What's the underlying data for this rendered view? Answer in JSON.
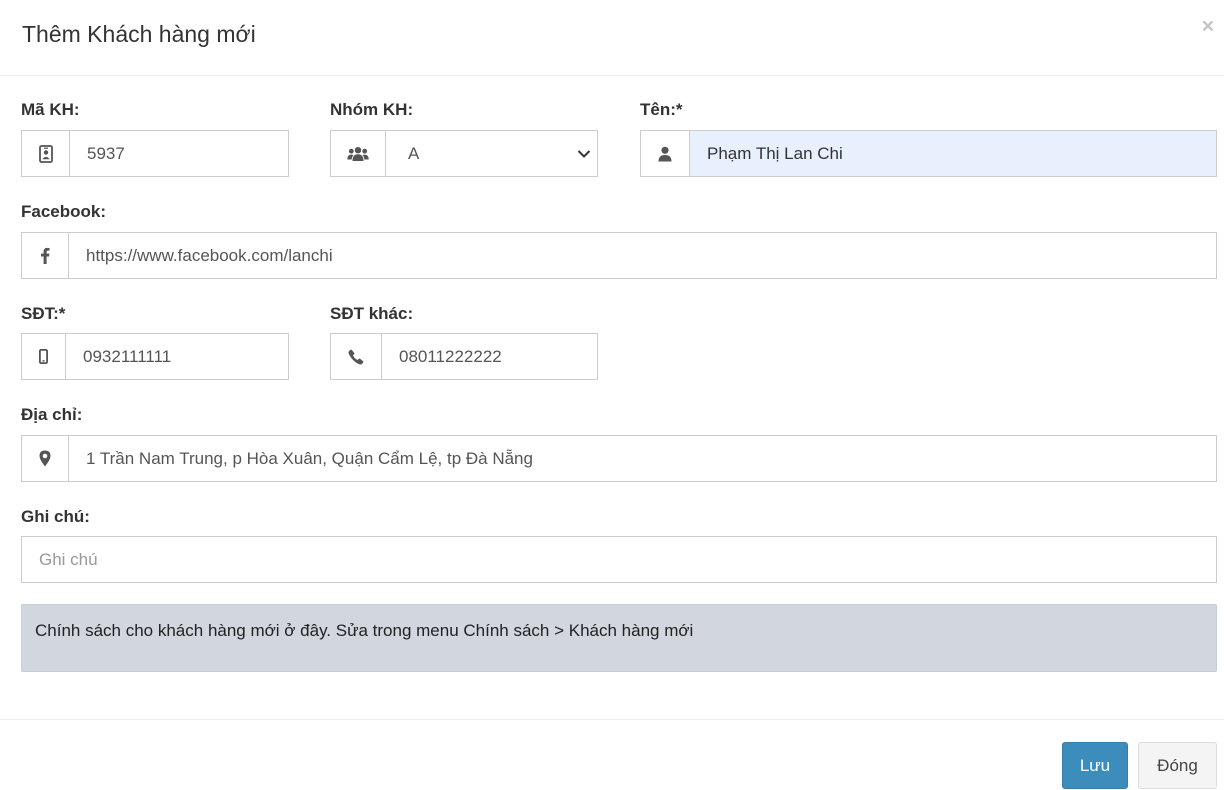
{
  "modal": {
    "title": "Thêm Khách hàng mới",
    "close_label": "×"
  },
  "form": {
    "ma_kh": {
      "label": "Mã KH:",
      "value": "5937",
      "icon": "id-card-icon"
    },
    "nhom_kh": {
      "label": "Nhóm KH:",
      "value": "A",
      "icon": "users-icon"
    },
    "ten": {
      "label": "Tên:*",
      "value": "Phạm Thị Lan Chi",
      "icon": "user-icon"
    },
    "facebook": {
      "label": "Facebook:",
      "value": "https://www.facebook.com/lanchi",
      "icon": "facebook-icon"
    },
    "sdt": {
      "label": "SĐT:*",
      "value": "0932111111",
      "icon": "mobile-icon"
    },
    "sdt_khac": {
      "label": "SĐT khác:",
      "value": "08011222222",
      "icon": "phone-icon"
    },
    "dia_chi": {
      "label": "Địa chỉ:",
      "value": "1 Trần Nam Trung, p Hòa Xuân, Quận Cẩm Lệ, tp Đà Nẵng",
      "icon": "map-marker-icon"
    },
    "ghi_chu": {
      "label": "Ghi chú:",
      "value": "",
      "placeholder": "Ghi chú"
    }
  },
  "notice": {
    "text": "Chính sách cho khách hàng mới ở đây. Sửa trong menu Chính sách > Khách hàng mới"
  },
  "footer": {
    "save_label": "Lưu",
    "close_label": "Đóng"
  },
  "colors": {
    "primary": "#3c8dbc",
    "notice_bg": "#d2d6de",
    "autofill_bg": "#e8f0fe"
  }
}
